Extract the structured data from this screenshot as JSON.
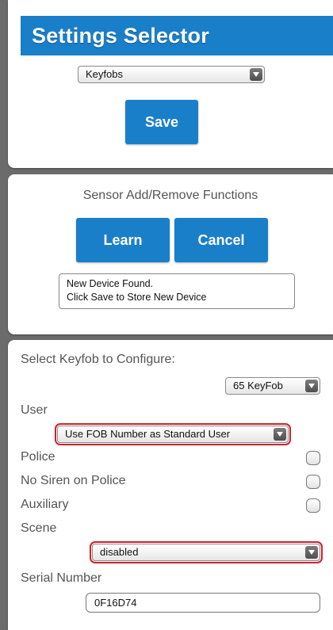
{
  "settings_selector": {
    "title": "Settings Selector",
    "device_type_select": "Keyfobs",
    "save_label": "Save"
  },
  "sensor_functions": {
    "heading": "Sensor Add/Remove Functions",
    "learn_label": "Learn",
    "cancel_label": "Cancel",
    "status_line1": "New Device Found.",
    "status_line2": "Click Save to Store New Device"
  },
  "keyfob_config": {
    "select_keyfob_label": "Select Keyfob to Configure:",
    "keyfob_select": "65 KeyFob",
    "user_label": "User",
    "user_select": "Use FOB Number as Standard User",
    "police_label": "Police",
    "no_siren_label": "No Siren on Police",
    "auxiliary_label": "Auxiliary",
    "scene_label": "Scene",
    "scene_select": "disabled",
    "serial_label": "Serial Number",
    "serial_value": "0F16D74"
  },
  "colors": {
    "accent": "#1a7fc9",
    "highlight_outline": "#d1202f",
    "background": "#6b6b6b"
  }
}
